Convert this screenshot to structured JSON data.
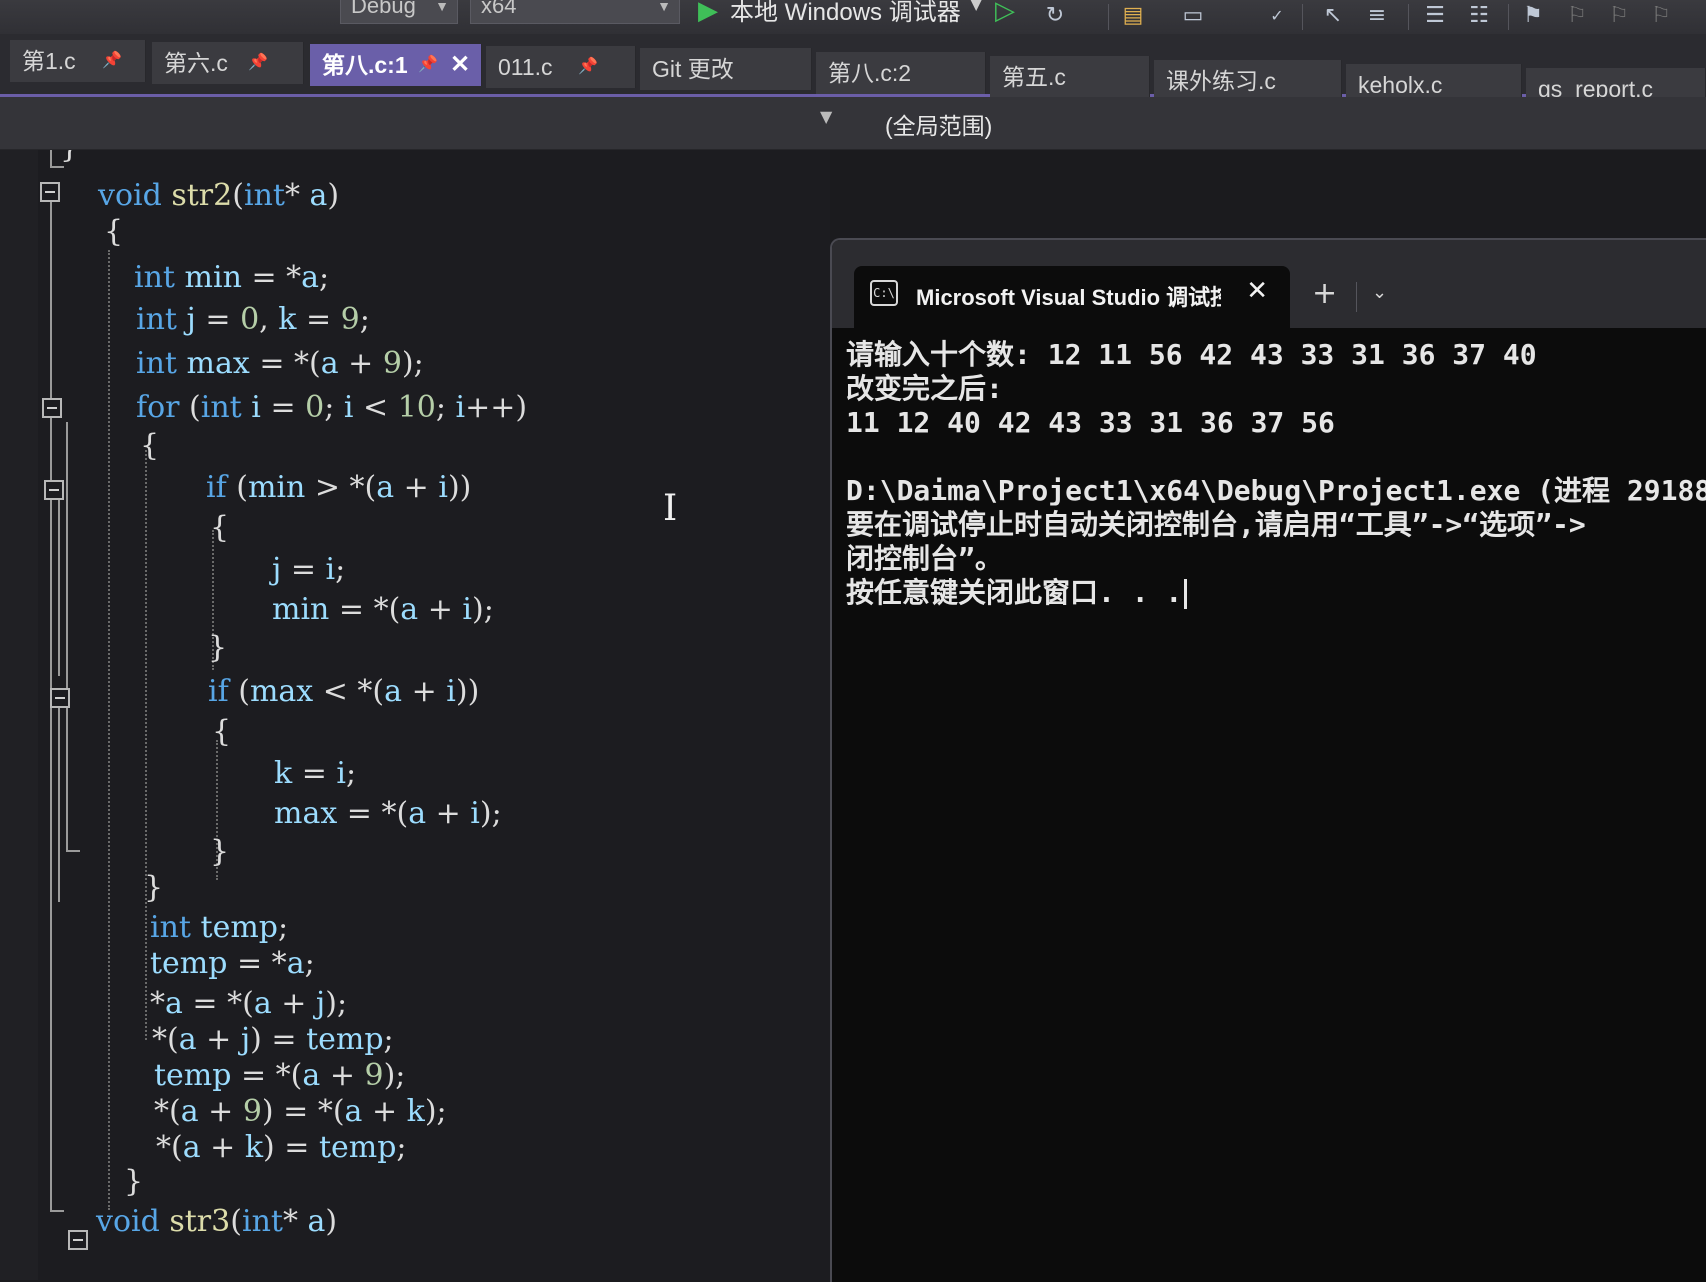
{
  "toolbar": {
    "config": "Debug",
    "platform": "x64",
    "debugger_label": "本地 Windows 调试器"
  },
  "tabs": [
    {
      "label": "第1.c",
      "pinned": true,
      "active": false
    },
    {
      "label": "第六.c",
      "pinned": true,
      "active": false
    },
    {
      "label": "第八.c:1",
      "pinned": true,
      "active": true
    },
    {
      "label": "011.c",
      "pinned": true,
      "active": false
    },
    {
      "label": "Git 更改",
      "pinned": false,
      "active": false
    },
    {
      "label": "第八.c:2",
      "pinned": false,
      "active": false
    },
    {
      "label": "第五.c",
      "pinned": false,
      "active": false
    },
    {
      "label": "课外练习.c",
      "pinned": false,
      "active": false
    },
    {
      "label": "keholx.c",
      "pinned": false,
      "active": false
    },
    {
      "label": "gs_report.c",
      "pinned": false,
      "active": false
    }
  ],
  "navbar": {
    "scope": "(全局范围)"
  },
  "code": [
    "}",
    "void str2(int* a)",
    "{",
    "int min = *a;",
    "int j = 0, k = 9;",
    "int max = *(a + 9);",
    "for (int i = 0; i < 10; i++)",
    "{",
    "if (min > *(a + i))",
    "{",
    "j = i;",
    "min = *(a + i);",
    "}",
    "if (max < *(a + i))",
    "{",
    "k = i;",
    "max = *(a + i);",
    "}",
    "}",
    "int temp;",
    "temp = *a;",
    "*a = *(a + j);",
    "*(a + j) = temp;",
    "temp = *(a + 9);",
    "*(a + 9) = *(a + k);",
    "*(a + k) = temp;",
    "}",
    "void str3(int* a)"
  ],
  "console": {
    "tab_title": "Microsoft Visual Studio 调试控制台",
    "lines": [
      "请输入十个数: 12 11 56 42 43 33 31 36 37 40",
      "改变完之后:",
      "11 12 40 42 43 33 31 36 37 56",
      "",
      "D:\\Daima\\Project1\\x64\\Debug\\Project1.exe (进程 29188",
      "要在调试停止时自动关闭控制台,请启用“工具”->“选项”->",
      "闭控制台”。",
      "按任意键关闭此窗口. . ."
    ]
  },
  "colors": {
    "active_tab": "#6a5fa9",
    "keyword": "#58a6e6",
    "function": "#dcdcaa",
    "variable": "#9cdcfe",
    "number": "#b5cea8"
  }
}
